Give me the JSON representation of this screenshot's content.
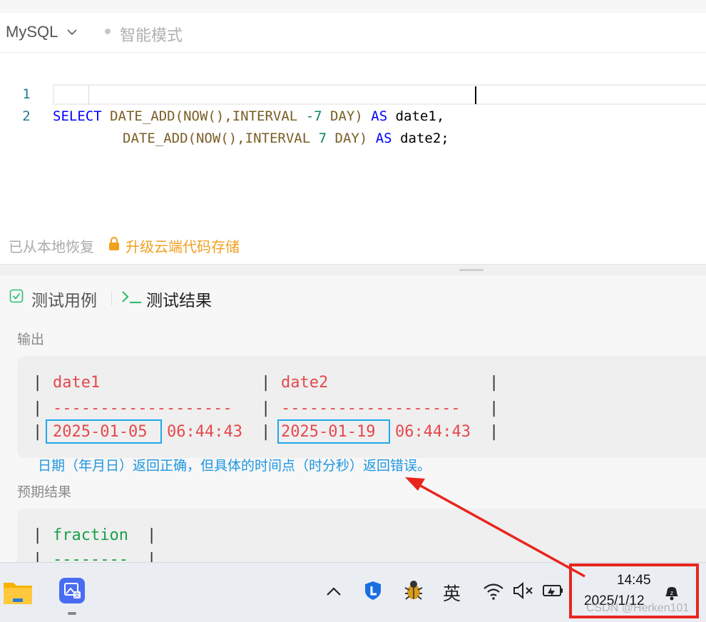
{
  "colors": {
    "accent": "#1e96e0",
    "highlight": "#1fa8ea",
    "annotation": "#e8261e",
    "result_text": "#e5484d",
    "upgrade": "#f0a020"
  },
  "editor": {
    "language": "MySQL",
    "mode": "智能模式",
    "lines": [
      {
        "num": "1"
      },
      {
        "num": "2"
      }
    ],
    "status_restore": "已从本地恢复",
    "status_upgrade": "升级云端代码存储"
  },
  "code": {
    "l1": {
      "kw1": "SELECT",
      "fn1": "DATE_ADD",
      "p1": "(",
      "fn2": "NOW",
      "p2": "(),",
      "kw2": "INTERVAL",
      "n1": "-7",
      "kw3": "DAY",
      "p3": ")",
      "kw4": "AS",
      "id1": "date1",
      "p4": ","
    },
    "l2": {
      "fn1": "DATE_ADD",
      "p1": "(",
      "fn2": "NOW",
      "p2": "(),",
      "kw2": "INTERVAL",
      "n1": "7",
      "kw3": "DAY",
      "p3": ")",
      "kw4": "AS",
      "id1": "date2",
      "p4": ";"
    }
  },
  "tabs": {
    "test_cases": "测试用例",
    "test_results": "测试结果"
  },
  "output": {
    "label": "输出",
    "col1": "date1",
    "col2": "date2",
    "sep1": "-------------------",
    "sep2": "-------------------",
    "r1_date": "2025-01-05",
    "r1_time": "06:44:43",
    "r2_date": "2025-01-19",
    "r2_time": "06:44:43",
    "pipe": "|"
  },
  "annotation": "日期（年月日）返回正确，但具体的时间点（时分秒）返回错误。",
  "expected": {
    "label": "预期结果",
    "col": "fraction",
    "sep": "--------"
  },
  "taskbar": {
    "ime": "英",
    "time": "14:45",
    "date": "2025/1/12",
    "watermark": "CSDN @Herken101"
  }
}
